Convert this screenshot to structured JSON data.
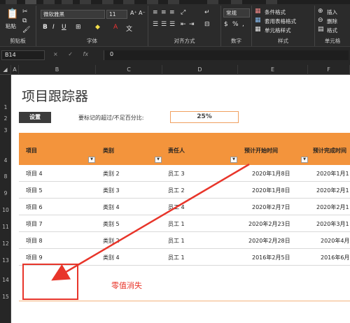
{
  "ribbon": {
    "paste_label": "粘贴",
    "clipboard_label": "剪贴板",
    "font_name": "微软雅黑",
    "font_size": "11",
    "font_group_label": "字体",
    "align_group_label": "对齐方式",
    "number_format": "常规",
    "number_group_label": "数字",
    "cond_format_label": "条件格式",
    "table_format_label": "套用表格格式",
    "cell_style_label": "单元格样式",
    "style_group_label": "样式",
    "insert_label": "插入",
    "delete_label": "删除",
    "format_label": "格式",
    "cells_group_label": "单元格"
  },
  "formula_bar": {
    "name_box": "B14",
    "cancel": "×",
    "enter": "✓",
    "fx": "fx",
    "value": "0"
  },
  "columns": [
    "A",
    "B",
    "C",
    "D",
    "E",
    "F"
  ],
  "rows": [
    "1",
    "2",
    "3",
    "4",
    "8",
    "9",
    "10",
    "11",
    "12",
    "13",
    "14",
    "15"
  ],
  "sheet": {
    "title": "项目跟踪器",
    "settings_button": "设置",
    "threshold_label": "要标记的超过/不足百分比:",
    "threshold_value": "25%",
    "headers": [
      "项目",
      "类别",
      "责任人",
      "预计开始时间",
      "预计完成时间"
    ],
    "data": [
      [
        "项目 4",
        "类别 2",
        "员工 3",
        "2020年1月8日",
        "2020年1月1"
      ],
      [
        "项目 5",
        "类别 3",
        "员工 2",
        "2020年1月8日",
        "2020年2月1"
      ],
      [
        "项目 6",
        "类别 4",
        "员工 4",
        "2020年2月7日",
        "2020年2月1"
      ],
      [
        "项目 7",
        "类别 5",
        "员工 1",
        "2020年2月23日",
        "2020年3月1"
      ],
      [
        "项目 8",
        "类别 2",
        "员工 1",
        "2020年2月28日",
        "2020年4月"
      ],
      [
        "项目 9",
        "类别 4",
        "员工 1",
        "2016年2月5日",
        "2016年6月"
      ]
    ]
  },
  "annotation": {
    "text": "零值消失",
    "color": "#e8352a"
  },
  "colors": {
    "header_orange": "#f3943c",
    "ribbon_bg": "#2b2b2b"
  }
}
